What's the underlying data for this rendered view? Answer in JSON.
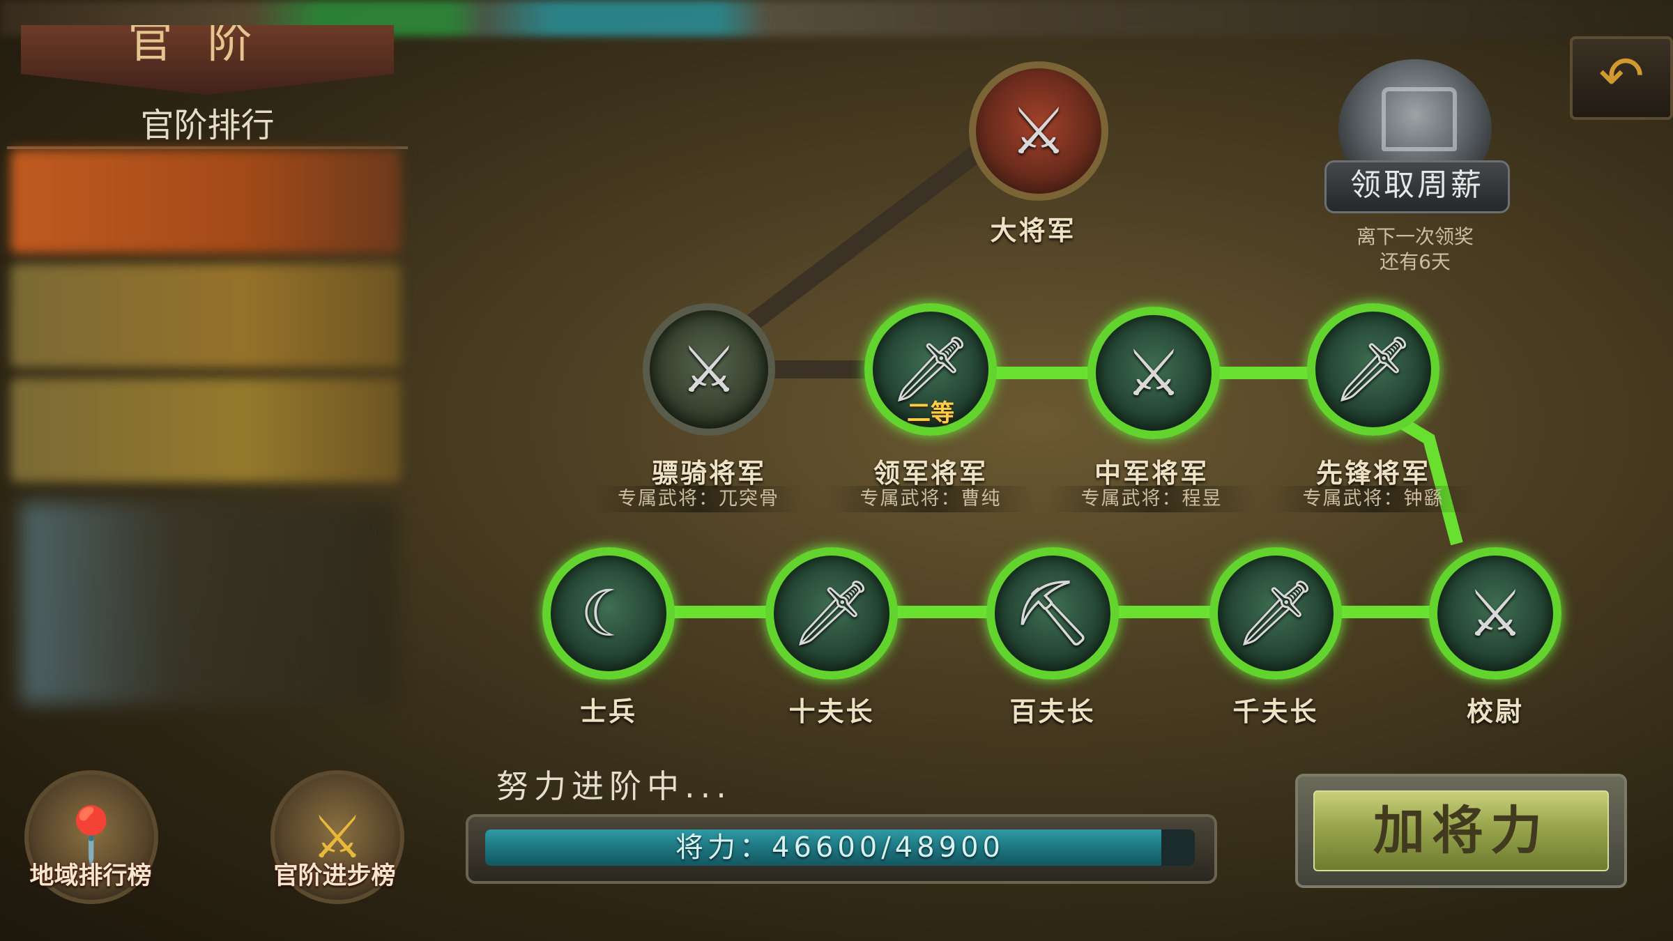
{
  "header": {
    "title": "官阶",
    "ranking_title": "官阶排行"
  },
  "weekly_salary": {
    "button_label": "领取周薪",
    "note_line1": "离下一次领奖",
    "note_line2": "还有6天"
  },
  "tree": {
    "top": {
      "name": "大将军"
    },
    "upper_row": [
      {
        "name": "骠骑将军",
        "general": "专属武将：兀突骨",
        "state": "locked"
      },
      {
        "name": "领军将军",
        "general": "专属武将：曹纯",
        "state": "active",
        "tag": "二等"
      },
      {
        "name": "中军将军",
        "general": "专属武将：程昱",
        "state": "active"
      },
      {
        "name": "先锋将军",
        "general": "专属武将：钟繇",
        "state": "active"
      }
    ],
    "lower_row": [
      {
        "name": "士兵",
        "state": "active"
      },
      {
        "name": "十夫长",
        "state": "active"
      },
      {
        "name": "百夫长",
        "state": "active"
      },
      {
        "name": "千夫长",
        "state": "active"
      },
      {
        "name": "校尉",
        "state": "active"
      }
    ]
  },
  "bottom_buttons": {
    "region_rank": "地域排行榜",
    "rank_progress": "官阶进步榜"
  },
  "progress": {
    "status": "努力进阶中...",
    "label": "将力：46600/48900",
    "current": 46600,
    "max": 48900
  },
  "action": {
    "add_power": "加将力"
  },
  "colors": {
    "active_ring": "#63d42e",
    "bar_fill": "#1b6f79"
  }
}
